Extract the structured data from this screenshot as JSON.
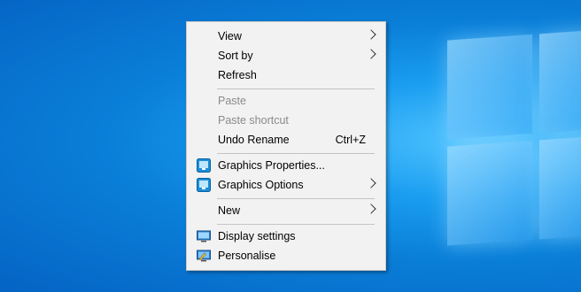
{
  "menu": {
    "items": [
      {
        "label": "View",
        "submenu": true
      },
      {
        "label": "Sort by",
        "submenu": true
      },
      {
        "label": "Refresh"
      },
      {
        "label": "Paste",
        "disabled": true
      },
      {
        "label": "Paste shortcut",
        "disabled": true
      },
      {
        "label": "Undo Rename",
        "shortcut": "Ctrl+Z"
      },
      {
        "label": "Graphics Properties...",
        "icon": "intel-graphics-icon"
      },
      {
        "label": "Graphics Options",
        "icon": "intel-graphics-icon",
        "submenu": true
      },
      {
        "label": "New",
        "submenu": true
      },
      {
        "label": "Display settings",
        "icon": "display-icon"
      },
      {
        "label": "Personalise",
        "icon": "personalise-icon",
        "highlighted": true
      }
    ]
  },
  "colors": {
    "highlight_border": "#e3141b",
    "menu_background": "#f2f2f2",
    "desktop_accent": "#0a7fd8"
  }
}
